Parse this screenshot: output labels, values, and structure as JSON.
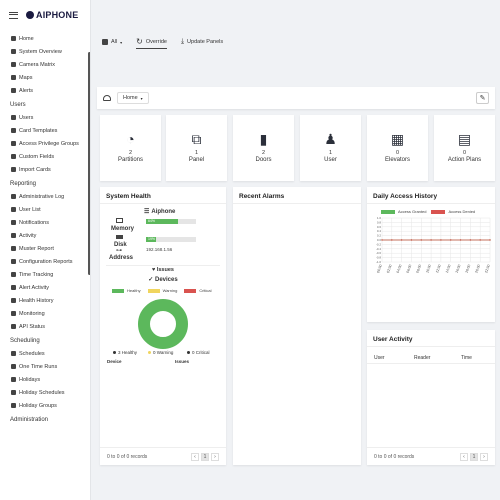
{
  "brand": {
    "name": "AIPHONE"
  },
  "sidebar": {
    "items_top": [
      {
        "label": "Home",
        "icon": "home-icon"
      },
      {
        "label": "System Overview",
        "icon": "network-icon"
      },
      {
        "label": "Camera Matrix",
        "icon": "camera-icon"
      },
      {
        "label": "Maps",
        "icon": "map-icon"
      },
      {
        "label": "Alerts",
        "icon": "bell-icon"
      }
    ],
    "users_label": "Users",
    "items_users": [
      {
        "label": "Users",
        "icon": "users-icon"
      },
      {
        "label": "Card Templates",
        "icon": "card-icon"
      },
      {
        "label": "Access Privilege Groups",
        "icon": "groups-icon"
      },
      {
        "label": "Custom Fields",
        "icon": "fields-icon"
      },
      {
        "label": "Import Cards",
        "icon": "import-icon"
      }
    ],
    "reporting_label": "Reporting",
    "items_reporting": [
      {
        "label": "Administrative Log",
        "icon": "log-icon"
      },
      {
        "label": "User List",
        "icon": "list-icon"
      },
      {
        "label": "Notifications",
        "icon": "notification-icon"
      },
      {
        "label": "Activity",
        "icon": "activity-icon"
      },
      {
        "label": "Muster Report",
        "icon": "muster-icon"
      },
      {
        "label": "Configuration Reports",
        "icon": "config-icon"
      },
      {
        "label": "Time Tracking",
        "icon": "clock-icon"
      },
      {
        "label": "Alert Activity",
        "icon": "alert-icon"
      },
      {
        "label": "Health History",
        "icon": "heart-icon"
      },
      {
        "label": "Monitoring",
        "icon": "monitor-icon"
      },
      {
        "label": "API Status",
        "icon": "api-icon"
      }
    ],
    "scheduling_label": "Scheduling",
    "items_scheduling": [
      {
        "label": "Schedules",
        "icon": "schedule-icon"
      },
      {
        "label": "One Time Runs",
        "icon": "run-icon"
      },
      {
        "label": "Holidays",
        "icon": "holiday-icon"
      },
      {
        "label": "Holiday Schedules",
        "icon": "holiday-schedule-icon"
      },
      {
        "label": "Holiday Groups",
        "icon": "holiday-group-icon"
      }
    ],
    "administration_label": "Administration"
  },
  "topbar": {
    "all_label": "All",
    "override_label": "Override",
    "update_label": "Update Panels"
  },
  "dashboard": {
    "selected": "Home"
  },
  "tiles": [
    {
      "count": "2",
      "label": "Partitions",
      "icon": "pie-chart-icon",
      "glyph": "◔"
    },
    {
      "count": "1",
      "label": "Panel",
      "icon": "network-icon",
      "glyph": "⧉"
    },
    {
      "count": "2",
      "label": "Doors",
      "icon": "door-icon",
      "glyph": "▮"
    },
    {
      "count": "1",
      "label": "User",
      "icon": "users-icon",
      "glyph": "♟"
    },
    {
      "count": "0",
      "label": "Elevators",
      "icon": "building-icon",
      "glyph": "▦"
    },
    {
      "count": "0",
      "label": "Action Plans",
      "icon": "clipboard-icon",
      "glyph": "▤"
    }
  ],
  "system_health": {
    "title": "System Health",
    "device_name": "Aiphone",
    "memory_label": "Memory",
    "memory_value": "64%",
    "memory_fraction": 0.64,
    "disk_label": "Disk",
    "disk_value": "19%",
    "disk_fraction": 0.19,
    "address_label": "Address",
    "address_value": "192.168.1.56",
    "issues_label": "Issues",
    "devices_label": "Devices",
    "legend": [
      "Healthy",
      "Warning",
      "Critical"
    ],
    "healthy": "3 Healthy",
    "warning": "0 Warning",
    "critical": "0 Critical",
    "col_device": "Device",
    "col_issues": "Issues",
    "footer": "0 to 0 of 0 records",
    "page": "1",
    "colors": {
      "healthy": "#5cb85c",
      "warning": "#f0ad4e",
      "critical": "#d9534f"
    }
  },
  "recent_alarms": {
    "title": "Recent Alarms"
  },
  "daily_access": {
    "title": "Daily Access History",
    "legend": [
      "Access Granted",
      "Access Denied"
    ],
    "colors": {
      "granted": "#5cb85c",
      "denied": "#d9534f"
    },
    "y_ticks": [
      "1.0",
      "0.8",
      "0.6",
      "0.4",
      "0.2",
      "0.0",
      "-0.2",
      "-0.4",
      "-0.6",
      "-0.8",
      "-1.0"
    ],
    "x_ticks": [
      "00:00",
      "02:00",
      "04:00",
      "06:00",
      "08:00",
      "10:00",
      "12:00",
      "14:00",
      "16:00",
      "18:00",
      "20:00",
      "22:00"
    ]
  },
  "chart_data": {
    "type": "line",
    "title": "Daily Access History",
    "categories": [
      "00:00",
      "02:00",
      "04:00",
      "06:00",
      "08:00",
      "10:00",
      "12:00",
      "14:00",
      "16:00",
      "18:00",
      "20:00",
      "22:00"
    ],
    "series": [
      {
        "name": "Access Granted",
        "values": [
          0,
          0,
          0,
          0,
          0,
          0,
          0,
          0,
          0,
          0,
          0,
          0
        ]
      },
      {
        "name": "Access Denied",
        "values": [
          0,
          0,
          0,
          0,
          0,
          0,
          0,
          0,
          0,
          0,
          0,
          0
        ]
      }
    ],
    "ylim": [
      -1,
      1
    ],
    "grid": true,
    "legend": "top"
  },
  "user_activity": {
    "title": "User Activity",
    "col_user": "User",
    "col_reader": "Reader",
    "col_time": "Time",
    "footer": "0 to 0 of 0 records",
    "page": "1"
  }
}
